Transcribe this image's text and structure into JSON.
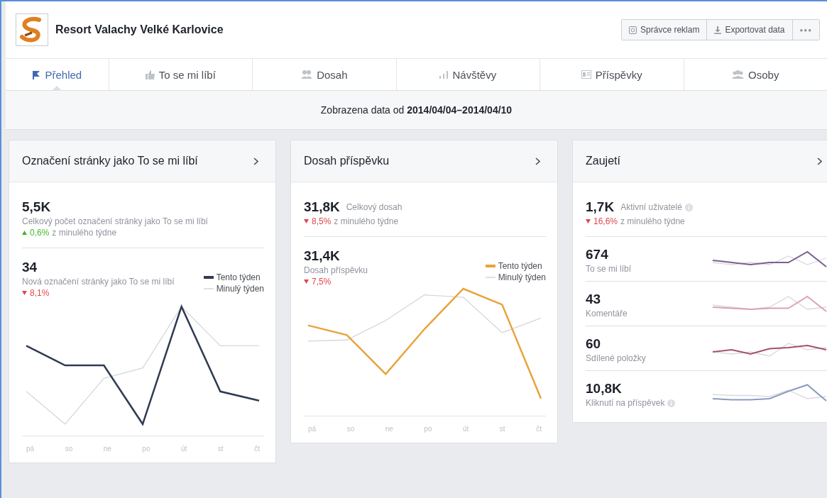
{
  "header": {
    "title": "Resort Valachy Velké Karlovice",
    "buttons": [
      {
        "kind": "ads",
        "label": "Správce reklam"
      },
      {
        "kind": "export",
        "label": "Exportovat data"
      },
      {
        "kind": "more",
        "label": "●●●"
      }
    ]
  },
  "tabs": [
    {
      "kind": "overview",
      "label": "Přehled",
      "selected": true
    },
    {
      "kind": "likes",
      "label": "To se mi líbí",
      "selected": false
    },
    {
      "kind": "reach",
      "label": "Dosah",
      "selected": false
    },
    {
      "kind": "visits",
      "label": "Návštěvy",
      "selected": false
    },
    {
      "kind": "posts",
      "label": "Příspěvky",
      "selected": false
    },
    {
      "kind": "people",
      "label": "Osoby",
      "selected": false
    }
  ],
  "date_range": {
    "prefix": "Zobrazena data od",
    "range": "2014/04/04–2014/04/10"
  },
  "cards": [
    {
      "title": "Označení stránky jako To se mi líbí",
      "summary": {
        "value": "5,5K",
        "label": "Celkový počet označení stránky jako To se mi líbí",
        "rising": true,
        "change": "0,6%",
        "change_suffix": "z minulého týdne",
        "inline": false
      },
      "detail": {
        "value": "34",
        "label": "Nová označení stránky jako To se mi líbí",
        "rising": false,
        "change": "8,1%"
      },
      "legend": [
        "Tento týden",
        "Minulý týden"
      ],
      "color": "#2f3b52",
      "days": [
        "pá",
        "so",
        "ne",
        "po",
        "út",
        "st",
        "čt"
      ]
    },
    {
      "title": "Dosah příspěvku",
      "summary": {
        "value": "31,8K",
        "label": "Celkový dosah",
        "rising": false,
        "change": "8,5%",
        "change_suffix": "z minulého týdne",
        "inline": true
      },
      "detail": {
        "value": "31,4K",
        "label": "Dosah příspěvku",
        "rising": false,
        "change": "7,5%"
      },
      "legend": [
        "Tento týden",
        "Minulý týden"
      ],
      "color": "#e8a33d",
      "days": [
        "pá",
        "so",
        "ne",
        "po",
        "út",
        "st",
        "čt"
      ]
    },
    {
      "title": "Zaujetí",
      "summary": {
        "value": "1,7K",
        "label": "Aktivní uživatelé",
        "rising": false,
        "change": "16,6%",
        "change_suffix": "z minulého týdne",
        "inline": true,
        "info": true
      },
      "metrics": [
        {
          "value": "674",
          "label": "To se mi líbí",
          "color": "#7b5f8f"
        },
        {
          "value": "43",
          "label": "Komentáře",
          "color": "#d9a3b5"
        },
        {
          "value": "60",
          "label": "Sdílené položky",
          "color": "#a5506c"
        },
        {
          "value": "10,8K",
          "label": "Kliknutí na příspěvek",
          "color": "#8a9cc0",
          "info": true
        }
      ]
    }
  ]
}
